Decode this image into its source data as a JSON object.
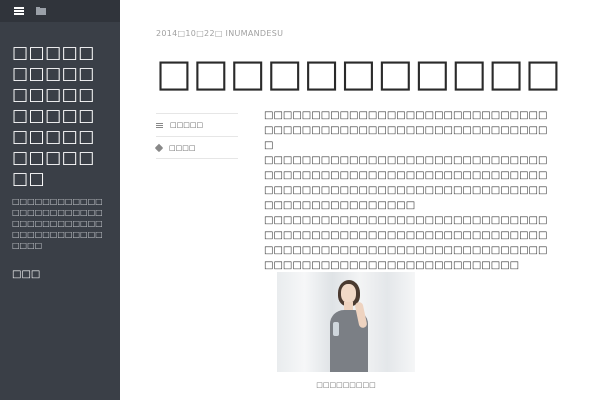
{
  "sidebar": {
    "icons": [
      "menu-icon",
      "folder-icon"
    ],
    "site_title": "□□□□□□□□□□□□□□□□□□□□□□□□□□□□□□□□",
    "site_description": "□□□□□□□□□□□□□□□□□□□□□□□□□□□□□□□□□□□□□□□□□□□□□□□□□□□□",
    "link_label": "□□□"
  },
  "post": {
    "meta": "2014□10□22□ INUMANDESU",
    "title": "□□□□□□□□□□□",
    "category_label": "□□□□□",
    "tag_label": "□□□□",
    "paragraphs": [
      "□□□□□□□□□□□□□□□□□□□□□□□□□□□□□□□□□□□□□□□□□□□□□□□□□□□□□□□□□□□□□",
      "□□□□□□□□□□□□□□□□□□□□□□□□□□□□□□□□□□□□□□□□□□□□□□□□□□□□□□□□□□□□□□□□□□□□□□□□□□□□□□□□□□□□□□□□□□□□□□□□□□□□□□□□□□",
      "□□□□□□□□□□□□□□□□□□□□□□□□□□□□□□□□□□□□□□□□□□□□□□□□□□□□□□□□□□□□",
      "□□□□□□□□□□□□□□□□□□□□□□□□□□□□□□□□□□□□□□□□□□□□□□□□□□□□□□□□□"
    ],
    "image_caption": "□□□□□□□□□"
  }
}
